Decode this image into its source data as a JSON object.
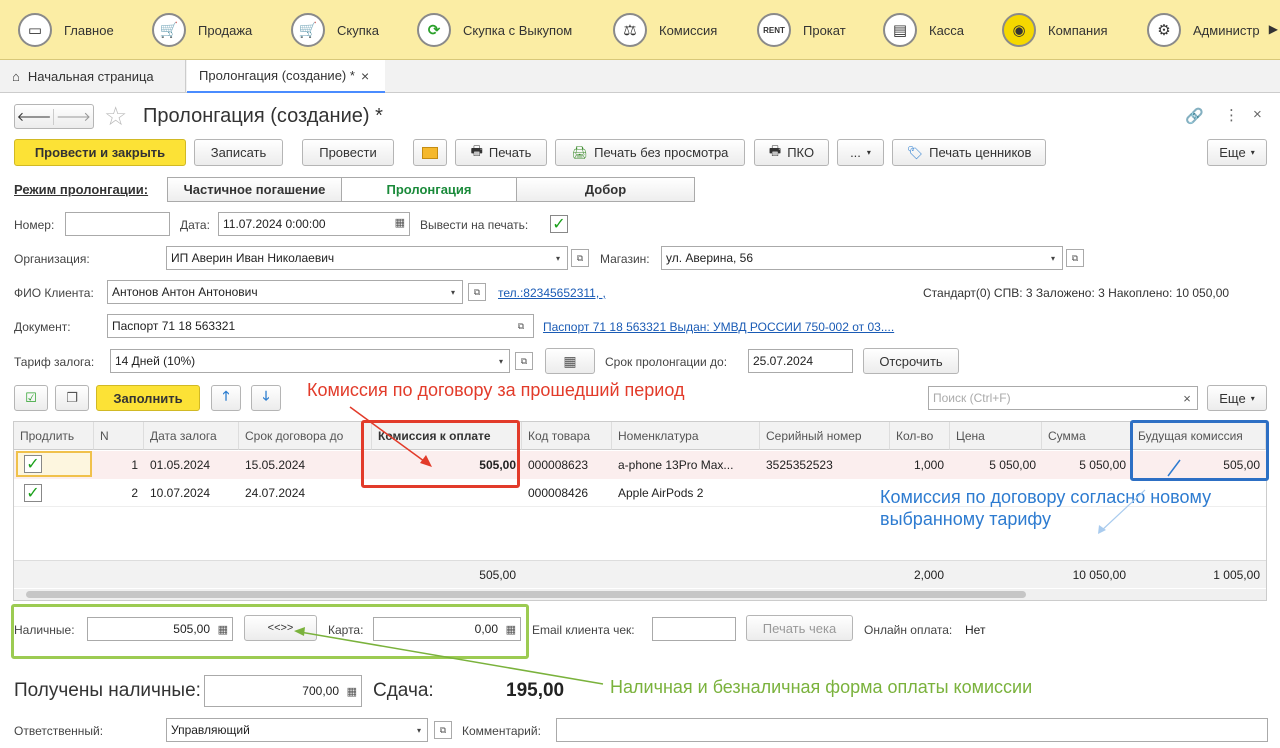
{
  "top_menu": [
    {
      "label": "Главное",
      "icon": "home-monitor-icon"
    },
    {
      "label": "Продажа",
      "icon": "cart-icon"
    },
    {
      "label": "Скупка",
      "icon": "cart-buy-icon"
    },
    {
      "label": "Скупка с Выкупом",
      "icon": "cycle-icon"
    },
    {
      "label": "Комиссия",
      "icon": "scales-icon"
    },
    {
      "label": "Прокат",
      "icon": "rent-icon"
    },
    {
      "label": "Касса",
      "icon": "cash-register-icon"
    },
    {
      "label": "Компания",
      "icon": "company-seal-icon"
    },
    {
      "label": "Администр",
      "icon": "admin-gears-icon"
    }
  ],
  "tabs": {
    "home": "Начальная страница",
    "active": "Пролонгация (создание) *",
    "close": "×"
  },
  "form": {
    "title": "Пролонгация (создание) *",
    "toolbar": {
      "post_close": "Провести и закрыть",
      "save": "Записать",
      "post": "Провести",
      "print": "Печать",
      "print_no_preview": "Печать без просмотра",
      "pko": "ПКО",
      "more_dots": "...",
      "print_tags": "Печать ценников",
      "more": "Еще"
    },
    "mode": {
      "label": "Режим пролонгации:",
      "options": [
        "Частичное погашение",
        "Пролонгация",
        "Добор"
      ]
    },
    "number_label": "Номер:",
    "number_value": "",
    "date_label": "Дата:",
    "date_value": "11.07.2024  0:00:00",
    "print_label": "Вывести на печать:",
    "org_label": "Организация:",
    "org_value": "ИП Аверин Иван Николаевич",
    "store_label": "Магазин:",
    "store_value": "ул. Аверина, 56",
    "client_label": "ФИО Клиента:",
    "client_value": "Антонов Антон Антонович",
    "client_phone": "тел.:82345652311, ,",
    "client_stats": "Стандарт(0) СПВ: 3 Заложено: 3 Накоплено: 10 050,00",
    "doc_label": "Документ:",
    "doc_value": "Паспорт 71 18 563321",
    "doc_link": "Паспорт 71 18 563321 Выдан: УМВД РОССИИ 750-002 от 03....",
    "tariff_label": "Тариф залога:",
    "tariff_value": "14 Дней (10%)",
    "prolong_label": "Срок пролонгации до:",
    "prolong_value": "25.07.2024",
    "delay_button": "Отсрочить"
  },
  "table_toolbar": {
    "fill": "Заполнить",
    "search_placeholder": "Поиск (Ctrl+F)",
    "more": "Еще"
  },
  "table": {
    "headers": [
      "Продлить",
      "N",
      "Дата залога",
      "Срок договора до",
      "Комиссия к оплате",
      "Код товара",
      "Номенклатура",
      "Серийный номер",
      "Кол-во",
      "Цена",
      "Сумма",
      "Будущая комиссия"
    ],
    "rows": [
      {
        "n": "1",
        "date": "01.05.2024",
        "term": "15.05.2024",
        "commission": "505,00",
        "code": "000008623",
        "name": "a-phone 13Pro Max...",
        "serial": "3525352523",
        "qty": "1,000",
        "price": "5 050,00",
        "sum": "5 050,00",
        "future": "505,00"
      },
      {
        "n": "2",
        "date": "10.07.2024",
        "term": "24.07.2024",
        "commission": "",
        "code": "000008426",
        "name": "Apple AirPods 2",
        "serial": "",
        "qty": "",
        "price": "",
        "sum": "",
        "future": ""
      }
    ],
    "totals": {
      "commission": "505,00",
      "qty": "2,000",
      "sum": "10 050,00",
      "future": "1 005,00"
    }
  },
  "payment": {
    "cash_label": "Наличные:",
    "cash_value": "505,00",
    "swap_button": "<<>>",
    "card_label": "Карта:",
    "card_value": "0,00",
    "email_label": "Email клиента чек:",
    "print_check": "Печать чека",
    "online_label": "Онлайн оплата:",
    "online_value": "Нет",
    "received_label": "Получены наличные:",
    "received_value": "700,00",
    "change_label": "Сдача:",
    "change_value": "195,00",
    "responsible_label": "Ответственный:",
    "responsible_value": "Управляющий",
    "comment_label": "Комментарий:"
  },
  "annotations": {
    "red": "Комиссия по договору за прошедший период",
    "blue": "Комиссия по договору согласно новому выбранному тарифу",
    "green": "Наличная и безналичная форма оплаты комиссии"
  },
  "colors": {
    "menu_bg": "#fbeda4",
    "accent_yellow": "#fce236",
    "annot_red": "#e23b2a",
    "annot_blue": "#2d7bd0",
    "annot_green": "#7ab23c"
  }
}
